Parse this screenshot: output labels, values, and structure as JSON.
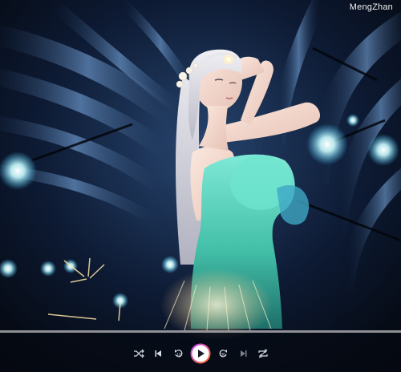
{
  "watermark": "MengZhan",
  "playback": {
    "state": "paused",
    "progress": 0.0
  },
  "controls": {
    "icons": [
      "shuffle-icon",
      "previous-icon",
      "rewind-icon",
      "play-icon",
      "forward-icon",
      "next-icon",
      "repeat-icon"
    ]
  },
  "colors": {
    "accent": "#ff6a1f",
    "accent_alt": "#c443ff",
    "control_glyph": "#d8dce4",
    "dress": "#5ad6bf",
    "stage_light": "#bff5ff"
  }
}
